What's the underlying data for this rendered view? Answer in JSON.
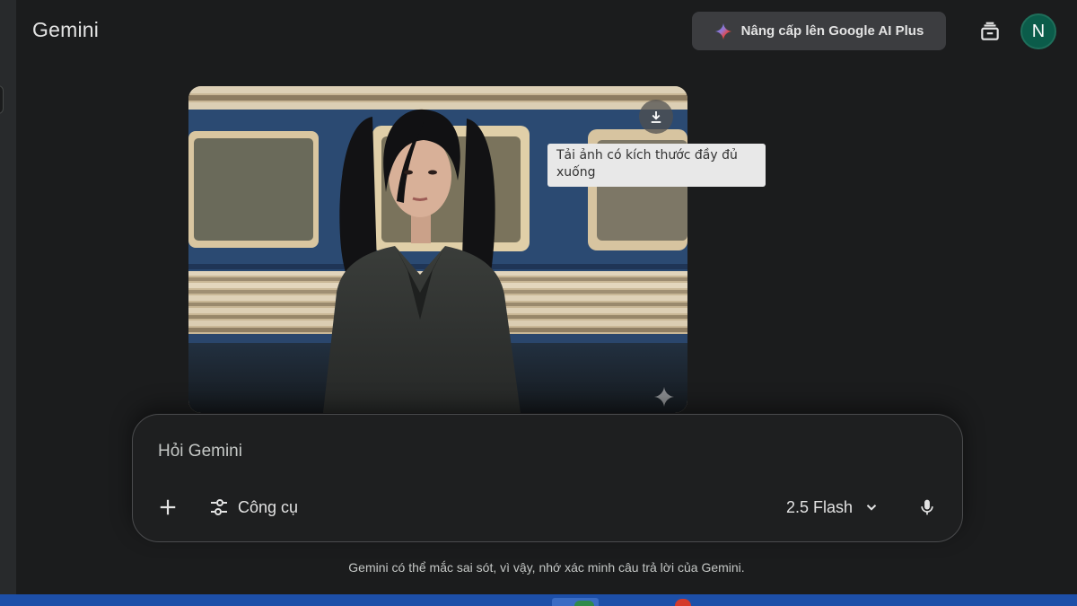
{
  "header": {
    "brand": "Gemini",
    "upgrade_label": "Nâng cấp lên Google AI Plus",
    "avatar_initial": "N",
    "icons": {
      "upgrade": "gemini-spark-icon",
      "history": "chat-history-icon"
    }
  },
  "image": {
    "download_tooltip": "Tải ảnh có kích thước đầy đủ xuống",
    "icons": {
      "download": "download-icon",
      "watermark": "sparkle-icon"
    }
  },
  "composer": {
    "placeholder": "Hỏi Gemini",
    "tools_label": "Công cụ",
    "model_label": "2.5 Flash",
    "icons": {
      "add": "plus-icon",
      "tools": "tune-icon",
      "model": "chevron-down-icon",
      "mic": "mic-icon"
    }
  },
  "footer": {
    "disclaimer": "Gemini có thể mắc sai sót, vì vậy, nhớ xác minh câu trả lời của Gemini."
  },
  "colors": {
    "background": "#1b1c1d",
    "surface": "#1e1f20",
    "button": "#3c3d40",
    "avatar": "#0b5c4a",
    "taskbar": "#1d4fa8"
  }
}
